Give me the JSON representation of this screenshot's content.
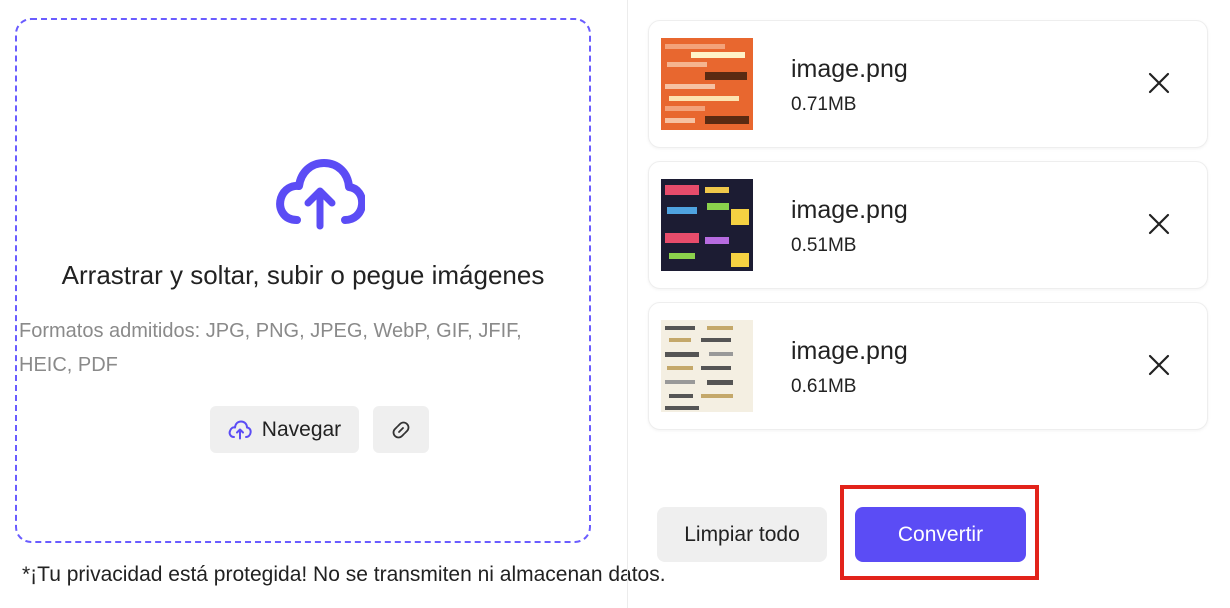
{
  "dropzone": {
    "title": "Arrastrar y soltar, subir o pegue imágenes",
    "formats_line1": "Formatos admitidos: JPG, PNG, JPEG, WebP, GIF, JFIF,",
    "formats_line2": "HEIC, PDF",
    "browse_label": "Navegar",
    "icon": "cloud-upload-icon",
    "link_icon": "link-icon"
  },
  "privacy_note": "*¡Tu privacidad está protegida! No se transmiten ni almacenan datos.",
  "files": [
    {
      "name": "image.png",
      "size": "0.71MB"
    },
    {
      "name": "image.png",
      "size": "0.51MB"
    },
    {
      "name": "image.png",
      "size": "0.61MB"
    }
  ],
  "actions": {
    "clear_label": "Limpiar todo",
    "convert_label": "Convertir"
  },
  "colors": {
    "accent": "#5b4cf5",
    "dashed_border": "#6a5cff",
    "highlight": "#e2231a"
  }
}
